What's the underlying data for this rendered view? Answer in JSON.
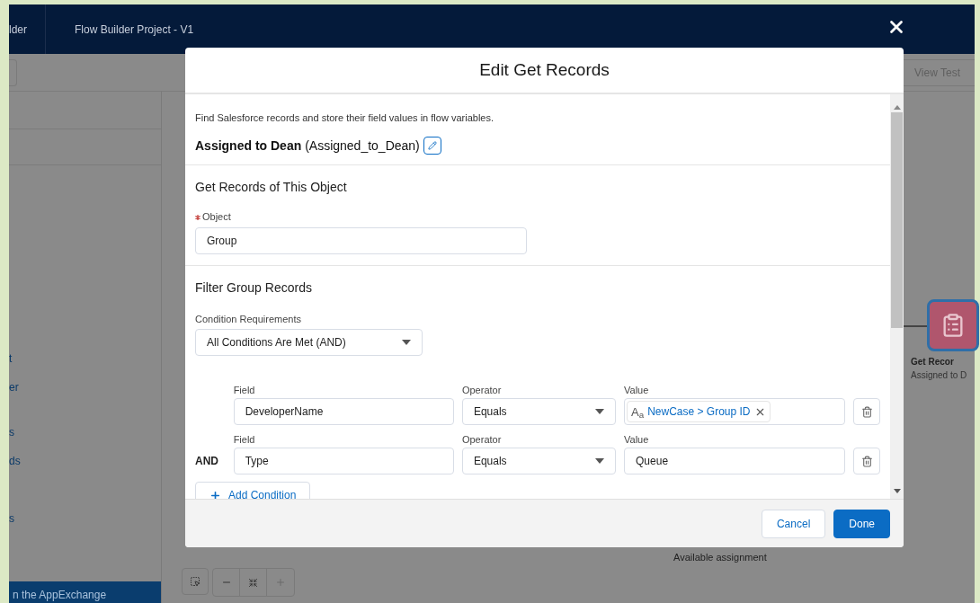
{
  "app_header": {
    "app_name": "lder",
    "project_title": "Flow Builder Project - V1"
  },
  "toolbar": {
    "button": "View Test"
  },
  "sidebar": {
    "items": [
      "t",
      "er",
      "s",
      "ds",
      "s"
    ],
    "footer": "n the AppExchange"
  },
  "canvas": {
    "node": {
      "title": "Get Recor",
      "label": "Assigned to D"
    },
    "assignment_label": "Available assignment"
  },
  "modal": {
    "title": "Edit Get Records",
    "description": "Find Salesforce records and store their field values in flow variables.",
    "element_name": "Assigned to Dean",
    "api_name": "(Assigned_to_Dean)",
    "object_section": {
      "title": "Get Records of This Object",
      "field_label": "Object",
      "required": true,
      "value": "Group"
    },
    "filter_section": {
      "title": "Filter Group Records",
      "requirements_label": "Condition Requirements",
      "requirements_value": "All Conditions Are Met (AND)",
      "conditions": [
        {
          "field_label": "Field",
          "field": "DeveloperName",
          "operator_label": "Operator",
          "operator": "Equals",
          "value_label": "Value",
          "value": "NewCase > Group ID",
          "type_glyph": "A$_{a}$",
          "kind": "reference"
        },
        {
          "logic": "AND",
          "field_label": "Field",
          "field": "Type",
          "operator_label": "Operator",
          "operator": "Equals",
          "value_label": "Value",
          "value": "Queue",
          "kind": "text"
        }
      ],
      "add_button": "Add Condition"
    },
    "buttons": {
      "cancel": "Cancel",
      "done": "Done"
    }
  }
}
